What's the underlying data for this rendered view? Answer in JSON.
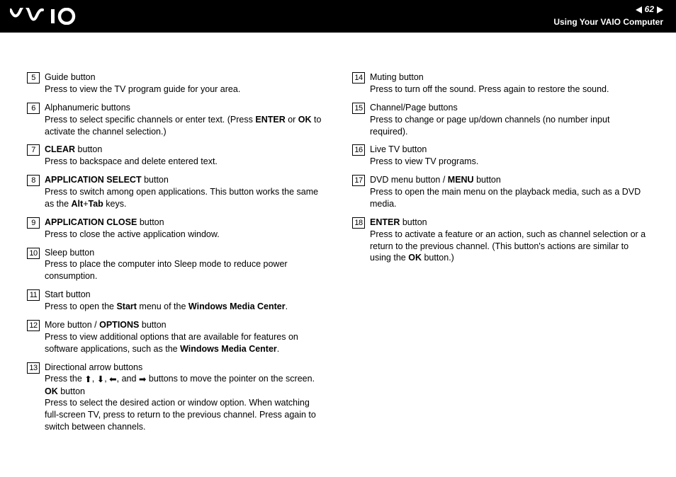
{
  "header": {
    "page_number": "62",
    "section": "Using Your VAIO Computer"
  },
  "left": [
    {
      "n": "5",
      "title": "Guide button",
      "desc": "Press to view the TV program guide for your area."
    },
    {
      "n": "6",
      "title": "Alphanumeric buttons",
      "desc": "Press to select specific channels or enter text. (Press <b>ENTER</b> or <b>OK</b> to activate the channel selection.)"
    },
    {
      "n": "7",
      "title": "<b>CLEAR</b> button",
      "desc": "Press to backspace and delete entered text."
    },
    {
      "n": "8",
      "title": "<b>APPLICATION SELECT</b> button",
      "desc": "Press to switch among open applications. This button works the same as the <b>Alt</b>+<b>Tab</b> keys."
    },
    {
      "n": "9",
      "title": "<b>APPLICATION CLOSE</b> button",
      "desc": "Press to close the active application window."
    },
    {
      "n": "10",
      "title": "Sleep button",
      "desc": "Press to place the computer into Sleep mode to reduce power consumption."
    },
    {
      "n": "11",
      "title": "Start button",
      "desc": "Press to open the <b>Start</b> menu of the <b>Windows Media Center</b>."
    },
    {
      "n": "12",
      "title": "More button / <b>OPTIONS</b> button",
      "desc": "Press to view additional options that are available for features on software applications, such as the <b>Windows Media Center</b>."
    },
    {
      "n": "13",
      "title": "Directional arrow buttons",
      "desc": "Press the <span class='arrow-icon'>&#x2B06;</span>, <span class='arrow-icon'>&#x2B07;</span>, <span class='arrow-icon'>&#x2B05;</span>, and <span class='arrow-icon'>&#x27A1;</span> buttons to move the pointer on the screen.<br><b>OK</b> button<br>Press to select the desired action or window option. When watching full-screen TV, press to return to the previous channel. Press again to switch between channels."
    }
  ],
  "right": [
    {
      "n": "14",
      "title": "Muting button",
      "desc": "Press to turn off the sound. Press again to restore the sound."
    },
    {
      "n": "15",
      "title": "Channel/Page buttons",
      "desc": "Press to change or page up/down channels (no number input required)."
    },
    {
      "n": "16",
      "title": "Live TV button",
      "desc": "Press to view TV programs."
    },
    {
      "n": "17",
      "title": "DVD menu button / <b>MENU</b> button",
      "desc": "Press to open the main menu on the playback media, such as a DVD media."
    },
    {
      "n": "18",
      "title": "<b>ENTER</b> button",
      "desc": "Press to activate a feature or an action, such as channel selection or a return to the previous channel. (This button's actions are similar to using the <b>OK</b> button.)"
    }
  ]
}
